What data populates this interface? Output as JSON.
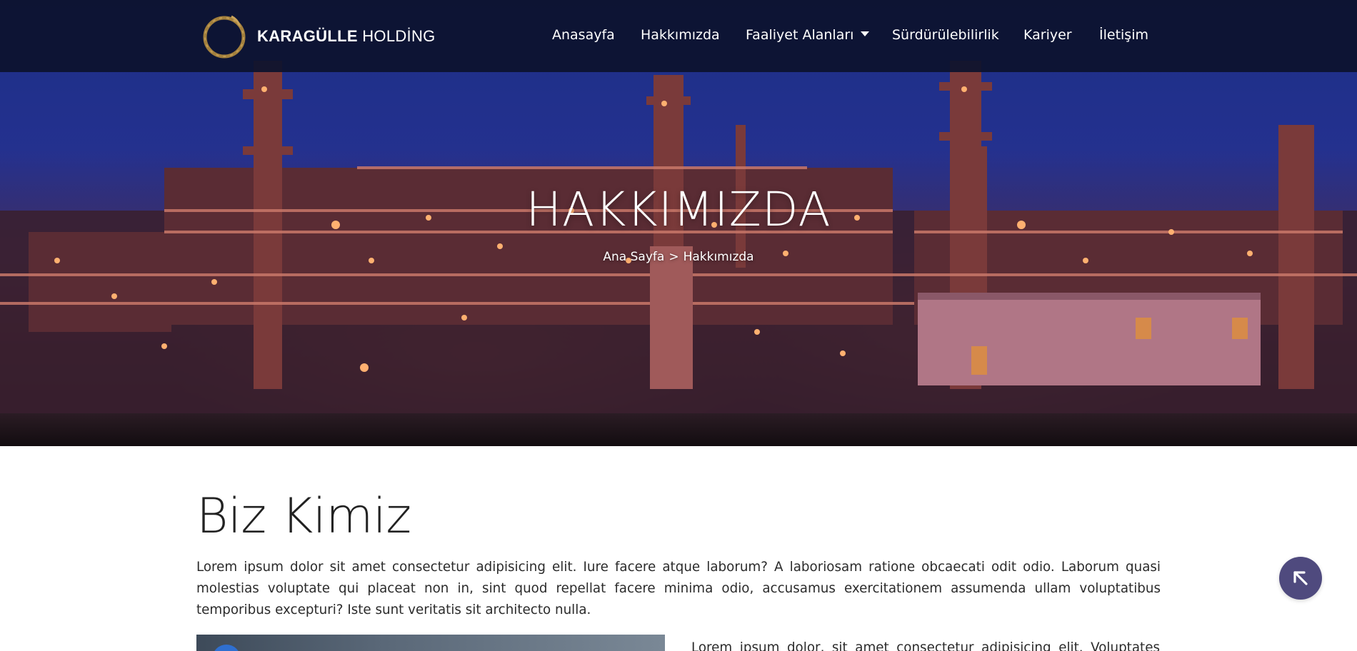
{
  "brand": {
    "name_bold": "KARAGÜLLE",
    "name_light": "HOLDİNG"
  },
  "nav": {
    "items": [
      {
        "label": "Anasayfa"
      },
      {
        "label": "Hakkımızda"
      },
      {
        "label": "Faaliyet Alanları"
      },
      {
        "label": "Sürdürülebilirlik"
      },
      {
        "label": "Kariyer"
      },
      {
        "label": "İletişim"
      }
    ]
  },
  "hero": {
    "title": "HAKKIMIZDA",
    "breadcrumb": {
      "home": "Ana Sayfa",
      "separator": ">",
      "current": "Hakkımızda"
    }
  },
  "about": {
    "heading": "Biz Kimiz",
    "intro": "Lorem ipsum dolor sit amet consectetur adipisicing elit. Iure facere atque laborum? A laboriosam ratione obcaecati odit odio. Laborum quasi molestias voluptate qui placeat non in, sint quod repellat facere minima odio, accusamus exercitationem assumenda ullam voluptatibus temporibus excepturi? Iste sunt veritatis sit architecto nulla.",
    "side_text": "Lorem ipsum dolor, sit amet consectetur adipisicing elit. Voluptates"
  },
  "icons": {
    "logo": "ring-logo-icon",
    "dropdown": "chevron-down-icon",
    "scroll_top": "arrow-up-left-icon"
  },
  "colors": {
    "navbar": "#0c122d",
    "scroll_top": "#4f4a7e",
    "text": "#2b2b2b"
  }
}
